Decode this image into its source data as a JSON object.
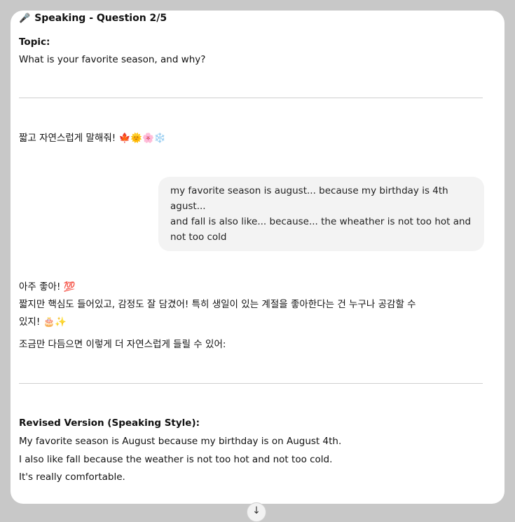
{
  "header": {
    "icon": "microphone-icon",
    "title": "Speaking - Question 2/5"
  },
  "topic": {
    "label": "Topic:",
    "text": "What is your favorite season, and why?"
  },
  "assistant_prompt": "짧고 자연스럽게 말해줘! 🍁🌞🌸❄️",
  "user_message": {
    "lines": [
      "my favorite season is august... because my birthday is 4th",
      "agust...",
      "and fall is also like... because... the wheather is not too hot and",
      "not too cold"
    ]
  },
  "feedback": {
    "line1": "아주 좋아! 💯",
    "line2": "짧지만 핵심도 들어있고, 감정도 잘 담겼어! 특히 생일이 있는 계절을 좋아한다는 건 누구나 공감할 수",
    "line3": "있지! 🎂✨",
    "line4": "조금만 다듬으면 이렇게 더 자연스럽게 들릴 수 있어:"
  },
  "revised": {
    "label": "Revised Version (Speaking Style):",
    "lines": [
      "My favorite season is August because my birthday is on August 4th.",
      "I also like fall because the weather is not too hot and not too cold.",
      "It's really comfortable."
    ]
  },
  "scroll_button": {
    "icon": "arrow-down-icon",
    "glyph": "↓"
  }
}
